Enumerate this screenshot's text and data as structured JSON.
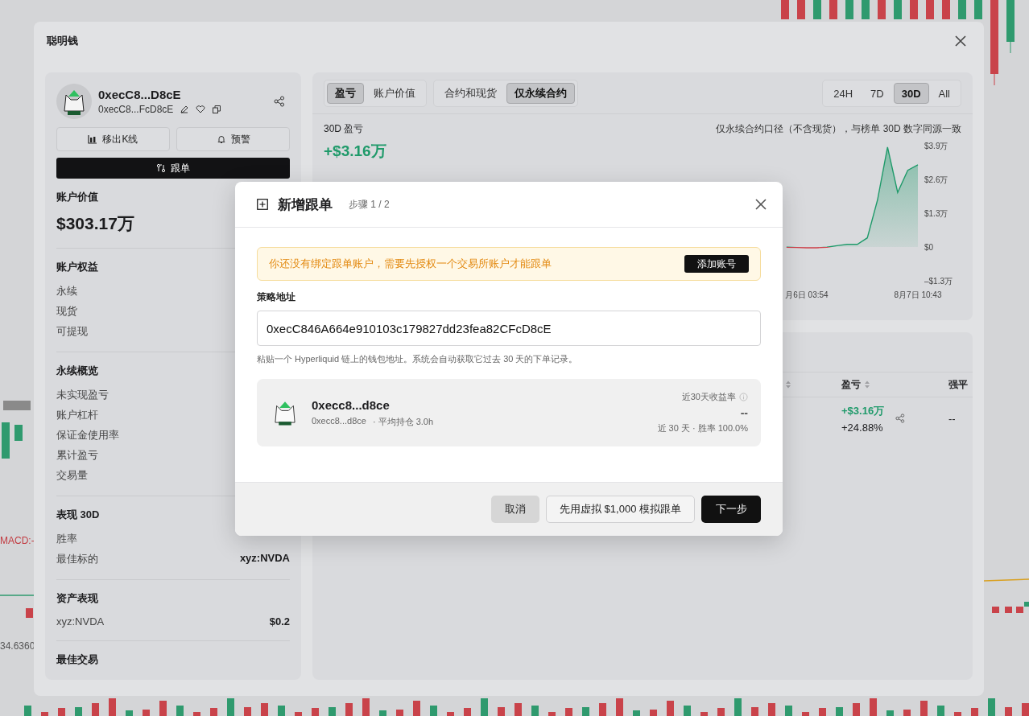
{
  "background": {
    "texts": [
      {
        "kind": "indicator",
        "text": "MACD:-"
      },
      {
        "kind": "price",
        "text": "34.6360"
      }
    ]
  },
  "window": {
    "title": "聪明钱"
  },
  "profile": {
    "name": "0xecC8...D8cE",
    "address": "0xecC8...FcD8cE"
  },
  "actions": [
    {
      "label": "移出K线",
      "kind": "candles"
    },
    {
      "label": "预警",
      "kind": "bell"
    }
  ],
  "follow_button": "跟单",
  "account_value": {
    "label": "账户价值",
    "value": "$303.17万"
  },
  "sections": [
    {
      "title": "账户权益",
      "rows": [
        {
          "label": "永续"
        },
        {
          "label": "现货"
        },
        {
          "label": "可提现"
        }
      ]
    },
    {
      "title": "永续概览",
      "rows": [
        {
          "label": "未实现盈亏"
        },
        {
          "label": "账户杠杆"
        },
        {
          "label": "保证金使用率"
        },
        {
          "label": "累计盈亏"
        },
        {
          "label": "交易量"
        }
      ]
    },
    {
      "title": "表现 30D",
      "rows": [
        {
          "label": "胜率"
        },
        {
          "label": "最佳标的",
          "value": "xyz:NVDA"
        }
      ]
    },
    {
      "title": "资产表现",
      "rows": [
        {
          "label": "xyz:NVDA",
          "value": "$0.2"
        }
      ]
    },
    {
      "title": "最佳交易"
    }
  ],
  "chart_panel": {
    "metric_tabs": [
      {
        "label": "盈亏",
        "selected": true
      },
      {
        "label": "账户价值",
        "selected": false
      }
    ],
    "scope_tabs": [
      {
        "label": "合约和现货",
        "selected": false
      },
      {
        "label": "仅永续合约",
        "selected": true
      }
    ],
    "range_tabs": [
      {
        "label": "24H",
        "selected": false
      },
      {
        "label": "7D",
        "selected": false
      },
      {
        "label": "30D",
        "selected": true
      },
      {
        "label": "All",
        "selected": false
      }
    ],
    "metric_label": "30D 盈亏",
    "metric_value": "+$3.16万",
    "note": "仅永续合约口径（不含现货），与榜单 30D 数字同源一致",
    "chart_data": {
      "type": "area",
      "categories": [
        null,
        null,
        null,
        null,
        null,
        null,
        null,
        null,
        null,
        null,
        null,
        null,
        null,
        null,
        null,
        null,
        null,
        null,
        null,
        null,
        null,
        null,
        null,
        null,
        null,
        null,
        null,
        null,
        null,
        null,
        null,
        null,
        null,
        null,
        null,
        null,
        null,
        null,
        null,
        null,
        null,
        null,
        null,
        null,
        null,
        null,
        null,
        null,
        "月6日 03:54",
        null,
        null,
        null,
        null,
        null,
        null,
        null,
        null,
        null,
        null,
        "8月7日 10:43"
      ],
      "series": [
        {
          "color": "#1f9a6a",
          "values": [
            null,
            null,
            null,
            null,
            null,
            null,
            null,
            null,
            null,
            null,
            null,
            null,
            null,
            null,
            null,
            null,
            null,
            null,
            null,
            null,
            null,
            null,
            null,
            null,
            null,
            null,
            null,
            null,
            null,
            null,
            null,
            null,
            null,
            null,
            null,
            null,
            null,
            null,
            null,
            null,
            null,
            null,
            null,
            null,
            null,
            null,
            -0.01,
            -0.02,
            -0.03,
            -0.03,
            -0.01,
            0.05,
            0.1,
            0.1,
            0.35,
            1.8,
            3.84,
            2.1,
            2.95,
            3.16
          ]
        }
      ],
      "ylim": [
        -1.3,
        3.9
      ],
      "yticks": [
        {
          "value": 3.9,
          "label": "$3.9万"
        },
        {
          "value": 2.6,
          "label": "$2.6万"
        },
        {
          "value": 1.3,
          "label": "$1.3万"
        },
        {
          "value": 0,
          "label": "$0"
        },
        {
          "value": -1.3,
          "label": "–$1.3万"
        }
      ]
    }
  },
  "table": {
    "columns": [
      {
        "kind": "hidden",
        "sortable": true
      },
      {
        "kind": "pnl",
        "label": "盈亏",
        "sortable": true
      },
      {
        "kind": "liquidation",
        "label": "强平",
        "sortable": false
      }
    ],
    "rows": [
      {
        "pnl": "+$3.16万",
        "pnl_pct": "+24.88%",
        "liquidation": "--"
      }
    ]
  },
  "modal": {
    "title": "新增跟单",
    "step": "步骤 1 / 2",
    "alert": {
      "text": "你还没有绑定跟单账户，需要先授权一个交易所账户才能跟单",
      "action": "添加账号"
    },
    "field": {
      "label": "策略地址",
      "value": "0xecC846A664e910103c179827dd23fea82CFcD8cE",
      "hint": "粘贴一个 Hyperliquid 链上的钱包地址。系统会自动获取它过去 30 天的下单记录。"
    },
    "trader": {
      "name": "0xecc8...d8ce",
      "address": "0xecc8...d8ce",
      "avg_hold": "· 平均持仓 3.0h",
      "return_label": "近30天收益率",
      "return_value": "--",
      "summary": "近 30 天 · 胜率 100.0%"
    },
    "buttons": [
      {
        "label": "取消",
        "kind": "secondary"
      },
      {
        "label": "先用虚拟 $1,000 模拟跟单",
        "kind": "outline"
      },
      {
        "label": "下一步",
        "kind": "primary"
      }
    ]
  }
}
